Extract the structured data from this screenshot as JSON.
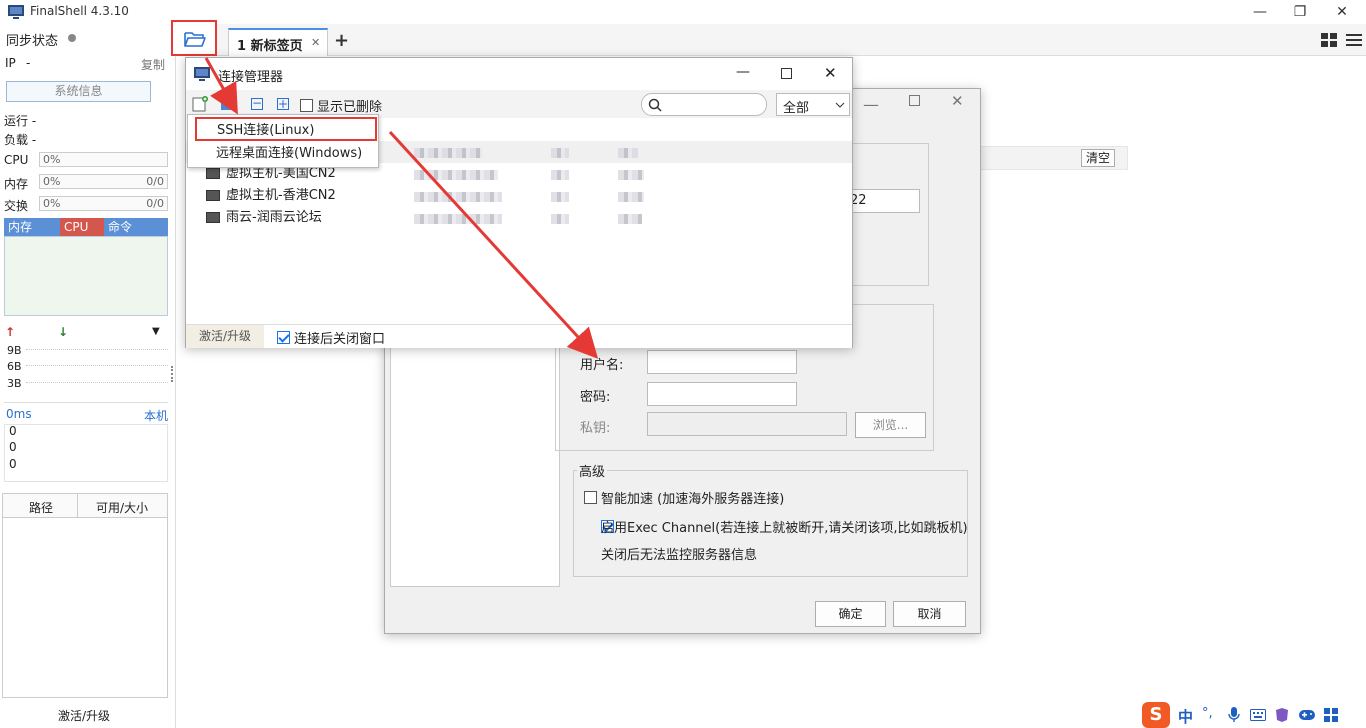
{
  "window": {
    "title": "FinalShell 4.3.10",
    "minimize": "—",
    "maximize": "❐",
    "close": "✕"
  },
  "sidebar": {
    "sync_label": "同步状态",
    "ip_label": "IP",
    "ip_value": "-",
    "copy": "复制",
    "sysinfo_button": "系统信息",
    "run_label": "运行 -",
    "load_label": "负载 -",
    "cpu_label": "CPU",
    "cpu_value": "0%",
    "mem_label": "内存",
    "mem_value": "0%",
    "mem_ratio": "0/0",
    "swap_label": "交换",
    "swap_value": "0%",
    "swap_ratio": "0/0",
    "tab_mem": "内存",
    "tab_cpu": "CPU",
    "tab_cmd": "命令",
    "net_up": "↑",
    "net_down": "↓",
    "net_menu": "▼",
    "net_levels": [
      "9B",
      "6B",
      "3B"
    ],
    "latency_label": "0ms",
    "local_label": "本机",
    "latency_values": [
      "0",
      "0",
      "0"
    ],
    "disk_col_path": "路径",
    "disk_col_size": "可用/大小",
    "activate": "激活/升级",
    "colors": {
      "mem_tab": "#5b8fd6",
      "cpu_tab": "#d4574e",
      "cmd_tab": "#5b8fd6"
    }
  },
  "tabs": {
    "folder_icon": "folder-open-icon",
    "tab1_label": "1 新标签页",
    "tab1_close": "✕",
    "add_tab": "+"
  },
  "right_strip": {
    "clear_button": "清空",
    "partial_value": "22"
  },
  "conn_dialog": {
    "username_label": "用户名:",
    "password_label": "密码:",
    "private_key_label": "私钥:",
    "browse_button": "浏览...",
    "advanced_label": "高级",
    "smart_accel": "智能加速 (加速海外服务器连接)",
    "exec_channel": "启用Exec Channel(若连接上就被断开,请关闭该项,比如跳板机)",
    "exec_note": "关闭后无法监控服务器信息",
    "ok_button": "确定",
    "cancel_button": "取消"
  },
  "conn_manager": {
    "title": "连接管理器",
    "show_deleted": "显示已删除",
    "filter_selected": "全部",
    "rows": [
      {
        "name": ""
      },
      {
        "name": "虚拟主机-美国CN2"
      },
      {
        "name": "虚拟主机-香港CN2"
      },
      {
        "name": "雨云-润雨云论坛"
      }
    ],
    "footer_activate": "激活/升级",
    "close_after_connect": "连接后关闭窗口"
  },
  "popup_menu": {
    "items": [
      "SSH连接(Linux)",
      "远程桌面连接(Windows)"
    ]
  },
  "ime": {
    "lang": "中",
    "punct": "°,"
  }
}
